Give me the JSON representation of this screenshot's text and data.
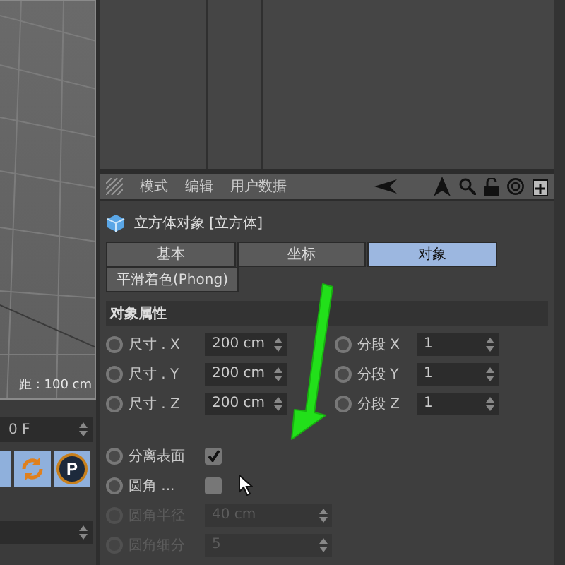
{
  "viewport": {
    "distance_label": "距 : 100 cm"
  },
  "left_panel": {
    "frame_field": "0 F",
    "p_button": "P"
  },
  "attributes": {
    "menus": [
      "模式",
      "编辑",
      "用户数据"
    ],
    "object_title": "立方体对象 [立方体]",
    "tabs": [
      {
        "label": "基本",
        "selected": false
      },
      {
        "label": "坐标",
        "selected": false
      },
      {
        "label": "对象",
        "selected": true
      }
    ],
    "subtab": "平滑着色(Phong)",
    "section": "对象属性",
    "size_rows": [
      {
        "animated": false,
        "label": "尺寸 . X",
        "value": "200 cm",
        "seg_animated": false,
        "seg_label": "分段 X",
        "seg_value": "1"
      },
      {
        "animated": false,
        "label": "尺寸 . Y",
        "value": "200 cm",
        "seg_animated": false,
        "seg_label": "分段 Y",
        "seg_value": "1"
      },
      {
        "animated": false,
        "label": "尺寸 . Z",
        "value": "200 cm",
        "seg_animated": false,
        "seg_label": "分段 Z",
        "seg_value": "1"
      }
    ],
    "options": [
      {
        "kind": "checkbox",
        "animated": false,
        "label": "分离表面",
        "checked": true,
        "disabled": false
      },
      {
        "kind": "checkbox",
        "animated": false,
        "label": "圆角 ...",
        "checked": false,
        "disabled": false
      },
      {
        "kind": "field",
        "label": "圆角半径",
        "value": "40 cm",
        "disabled": true
      },
      {
        "kind": "field",
        "label": "圆角细分",
        "value": "5",
        "disabled": true
      }
    ]
  }
}
